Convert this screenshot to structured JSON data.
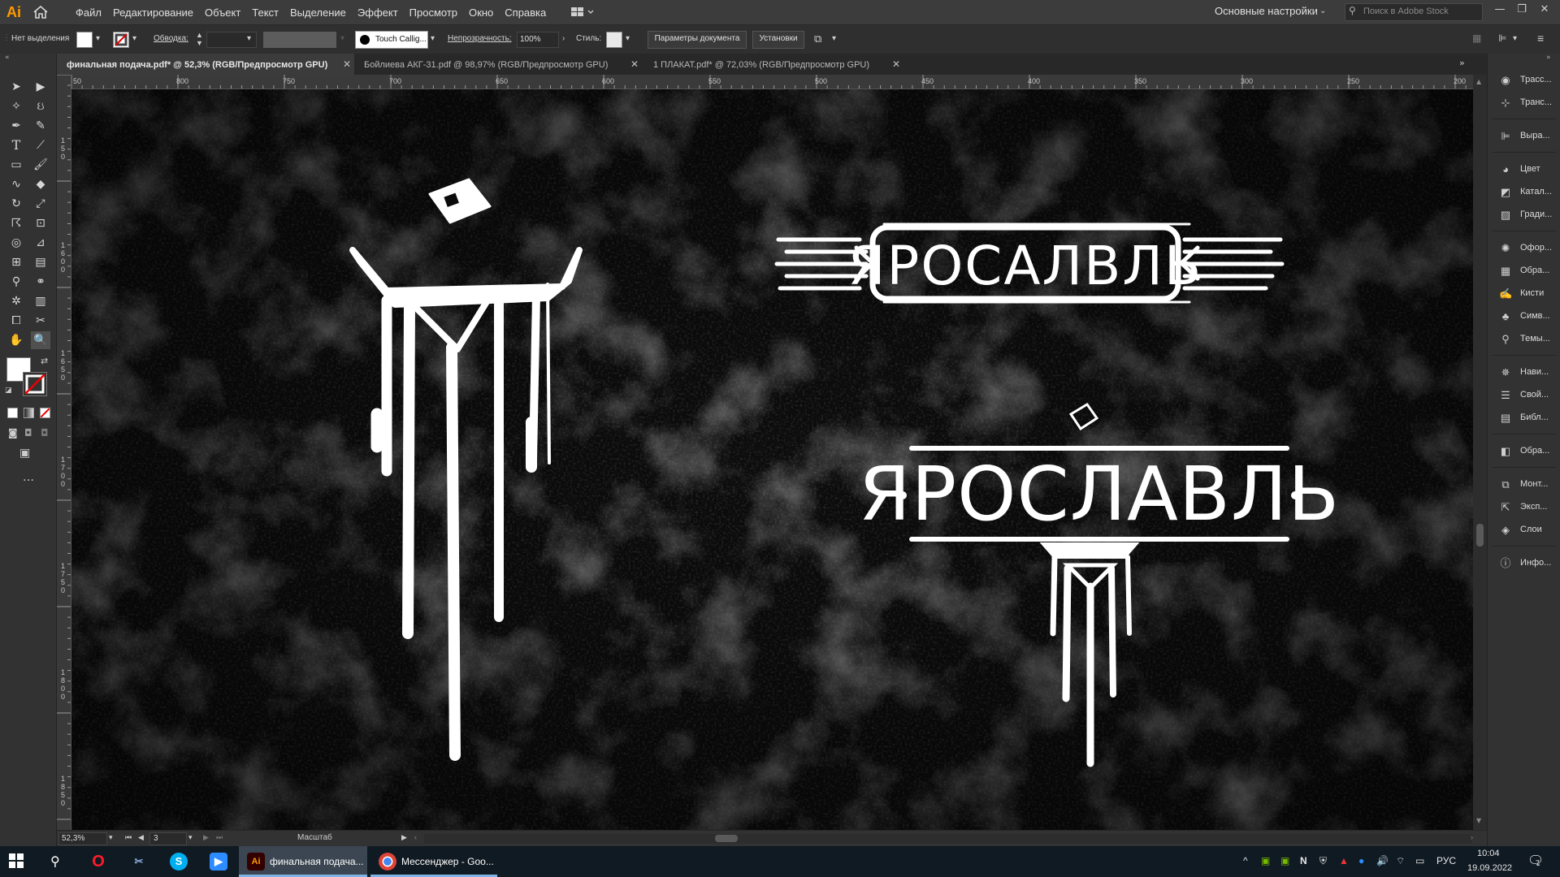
{
  "menubar": {
    "items": [
      "Файл",
      "Редактирование",
      "Объект",
      "Текст",
      "Выделение",
      "Эффект",
      "Просмотр",
      "Окно",
      "Справка"
    ],
    "workspace": "Основные настройки",
    "stock_placeholder": "Поиск в Adobe Stock",
    "app_logo": "Ai"
  },
  "controlbar": {
    "selection": "Нет выделения",
    "stroke_label": "Обводка:",
    "brush": "Touch Callig...",
    "opacity_label": "Непрозрачность:",
    "opacity_value": "100%",
    "style_label": "Стиль:",
    "doc_params": "Параметры документа",
    "preferences": "Установки"
  },
  "tabs": [
    {
      "label": "финальная подача.pdf* @ 52,3% (RGB/Предпросмотр GPU)",
      "active": true
    },
    {
      "label": "Бойлиева АКГ-31.pdf @ 98,97% (RGB/Предпросмотр GPU)",
      "active": false
    },
    {
      "label": "1 ПЛАКАТ.pdf* @ 72,03% (RGB/Предпросмотр GPU)",
      "active": false
    }
  ],
  "ruler_top": [
    "50",
    "800",
    "750",
    "700",
    "650",
    "600",
    "550",
    "500",
    "450",
    "400",
    "350",
    "300",
    "250",
    "200"
  ],
  "ruler_left": [
    "1 5 0",
    "1 6 0 0",
    "1 6 5 0",
    "1 7 0 0",
    "1 7 5 0",
    "1 8 0 0",
    "1 8 5 0"
  ],
  "artwork": {
    "logo_text_top": "ЯРОСАЛВЛЬ",
    "logo_text_bottom": "ЯРОСЛАВЛЬ"
  },
  "right_panels": [
    {
      "label": "Трасс...",
      "icon": "trace-icon"
    },
    {
      "label": "Транс...",
      "icon": "transform-icon"
    },
    {
      "label": "Выра...",
      "icon": "align-icon"
    },
    {
      "label": "Цвет",
      "icon": "color-icon"
    },
    {
      "label": "Катал...",
      "icon": "swatches-icon"
    },
    {
      "label": "Гради...",
      "icon": "gradient-icon"
    },
    {
      "label": "Офор...",
      "icon": "appearance-icon"
    },
    {
      "label": "Обра...",
      "icon": "graphic-styles-icon"
    },
    {
      "label": "Кисти",
      "icon": "brushes-icon"
    },
    {
      "label": "Симв...",
      "icon": "symbols-icon"
    },
    {
      "label": "Темы...",
      "icon": "themes-icon"
    },
    {
      "label": "Нави...",
      "icon": "navigator-icon"
    },
    {
      "label": "Свой...",
      "icon": "properties-icon"
    },
    {
      "label": "Библ...",
      "icon": "libraries-icon"
    },
    {
      "label": "Обра...",
      "icon": "image-trace-icon"
    },
    {
      "label": "Монт...",
      "icon": "artboards-icon"
    },
    {
      "label": "Эксп...",
      "icon": "export-icon"
    },
    {
      "label": "Слои",
      "icon": "layers-icon"
    },
    {
      "label": "Инфо...",
      "icon": "info-icon"
    }
  ],
  "statusbar": {
    "zoom": "52,3%",
    "artboard": "3",
    "mode": "Масштаб"
  },
  "taskbar": {
    "apps": [
      {
        "label": "финальная подача...",
        "icon": "illustrator-icon"
      },
      {
        "label": "Мессенджер - Goo...",
        "icon": "chrome-icon"
      }
    ],
    "lang": "РУС",
    "time": "10:04",
    "date": "19.09.2022",
    "notifications": "7"
  },
  "colors": {
    "ai_orange": "#ff9a00",
    "canvas": "#0b0b0b",
    "artwork": "#ffffff"
  }
}
